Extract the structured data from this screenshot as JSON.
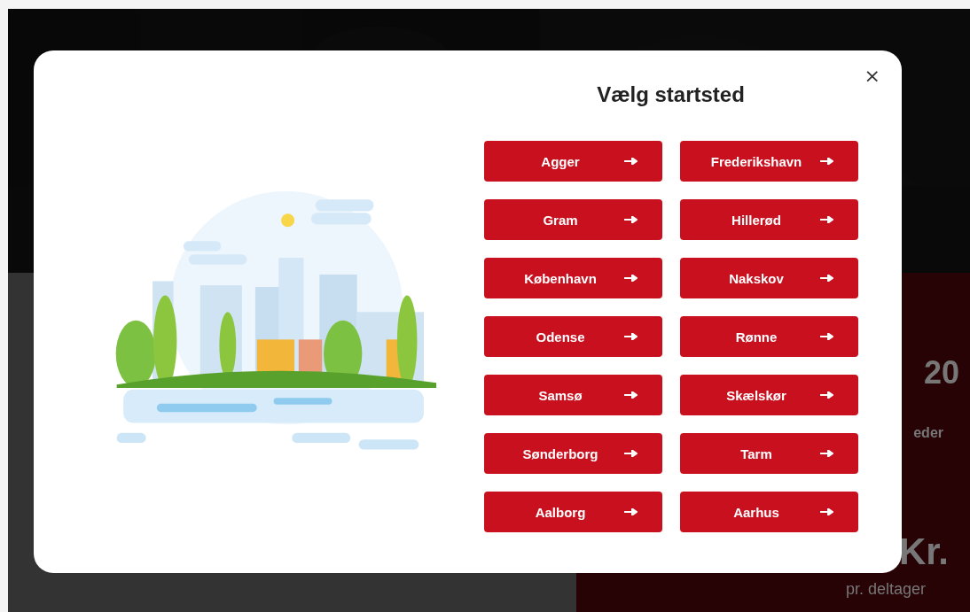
{
  "background_page": {
    "price_panel": {
      "heading": "20",
      "line": "eder",
      "price": "Kr.",
      "unit": "pr. deltager"
    }
  },
  "modal": {
    "title": "Vælg startsted",
    "close": "×",
    "locations": [
      {
        "label": "Agger"
      },
      {
        "label": "Frederikshavn"
      },
      {
        "label": "Gram"
      },
      {
        "label": "Hillerød"
      },
      {
        "label": "København"
      },
      {
        "label": "Nakskov"
      },
      {
        "label": "Odense"
      },
      {
        "label": "Rønne"
      },
      {
        "label": "Samsø"
      },
      {
        "label": "Skælskør"
      },
      {
        "label": "Sønderborg"
      },
      {
        "label": "Tarm"
      },
      {
        "label": "Aalborg"
      },
      {
        "label": "Aarhus"
      }
    ]
  }
}
